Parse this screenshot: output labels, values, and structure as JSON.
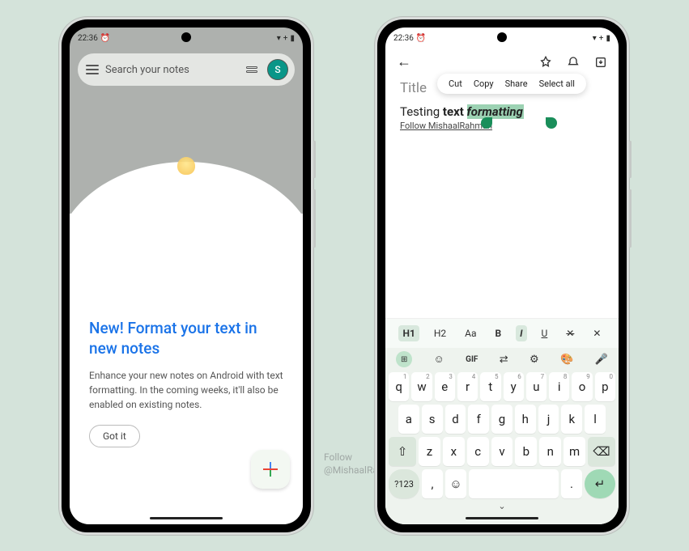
{
  "status": {
    "time": "22:36",
    "alarm_icon": "⏰",
    "wifi": "▾",
    "plus": "+",
    "battery": "▮"
  },
  "left": {
    "search_placeholder": "Search your notes",
    "avatar_initial": "S",
    "promo_title": "New! Format your text in new notes",
    "promo_body": "Enhance your new notes on Android with text formatting. In the coming weeks, it'll also be enabled on existing notes.",
    "got_it": "Got it"
  },
  "right": {
    "title_placeholder": "Title",
    "context_menu": [
      "Cut",
      "Copy",
      "Share",
      "Select all"
    ],
    "body_normal": "Testing ",
    "body_bold": "text ",
    "body_italic": "formatting",
    "body_line2": "Follow MishaalRahman",
    "fmt": {
      "h1": "H1",
      "h2": "H2",
      "aa": "Aa",
      "b": "B",
      "i": "I",
      "u": "U",
      "clear": "✕̵",
      "close": "✕"
    }
  },
  "kb": {
    "tools": {
      "grid": "⊞",
      "sticker": "☺",
      "gif": "GIF",
      "translate": "⇄",
      "settings": "⚙",
      "palette": "🎨",
      "mic": "🎤"
    },
    "row1": [
      {
        "k": "q",
        "s": "1"
      },
      {
        "k": "w",
        "s": "2"
      },
      {
        "k": "e",
        "s": "3"
      },
      {
        "k": "r",
        "s": "4"
      },
      {
        "k": "t",
        "s": "5"
      },
      {
        "k": "y",
        "s": "6"
      },
      {
        "k": "u",
        "s": "7"
      },
      {
        "k": "i",
        "s": "8"
      },
      {
        "k": "o",
        "s": "9"
      },
      {
        "k": "p",
        "s": "0"
      }
    ],
    "row2": [
      "a",
      "s",
      "d",
      "f",
      "g",
      "h",
      "j",
      "k",
      "l"
    ],
    "row3": {
      "shift": "⇧",
      "keys": [
        "z",
        "x",
        "c",
        "v",
        "b",
        "n",
        "m"
      ],
      "back": "⌫"
    },
    "row4": {
      "sym": "?123",
      "comma": ",",
      "emoji": "☺",
      "period": ".",
      "enter": "↵"
    },
    "collapse": "⌄"
  },
  "watermark": {
    "l1": "Follow",
    "l2": "@MishaalRahman"
  }
}
